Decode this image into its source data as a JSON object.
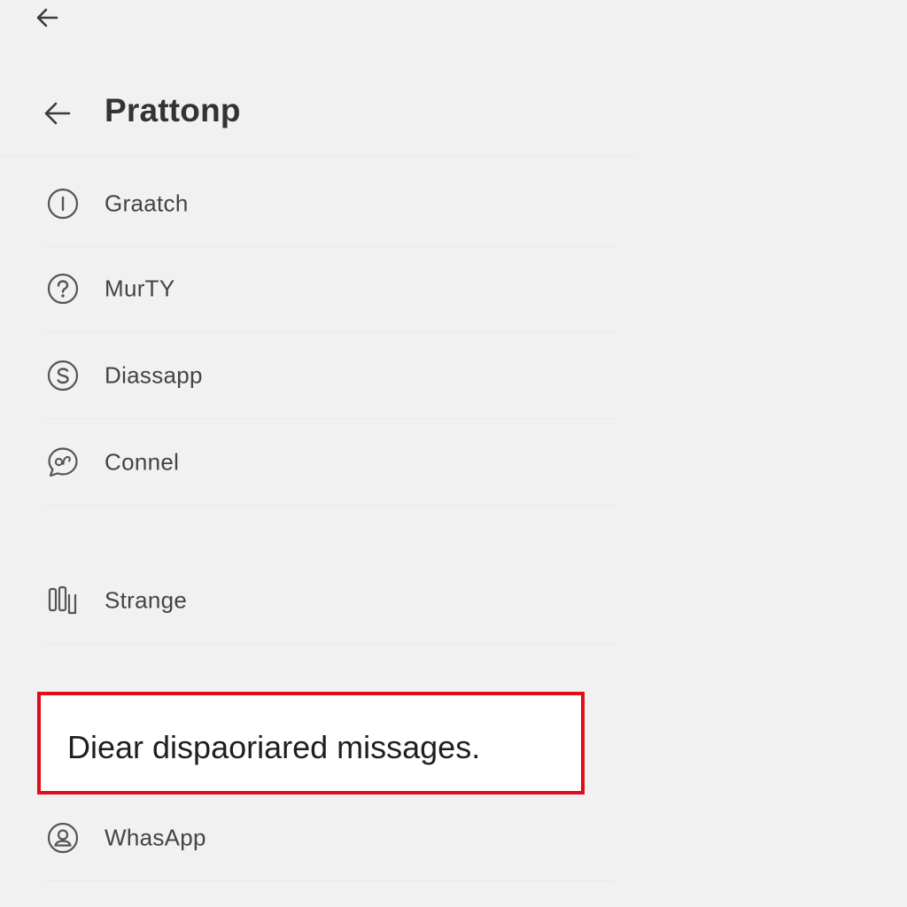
{
  "header": {
    "title": "Prattonp"
  },
  "menu": {
    "items": [
      {
        "label": "Graatch",
        "icon": "info-circle-icon"
      },
      {
        "label": "MurTY",
        "icon": "help-circle-icon"
      },
      {
        "label": "Diassapp",
        "icon": "s-circle-icon"
      },
      {
        "label": "Connel",
        "icon": "chat-bubble-icon"
      },
      {
        "label": "Strange",
        "icon": "storage-bars-icon"
      },
      {
        "label": "WhasApp",
        "icon": "account-circle-icon"
      }
    ]
  },
  "callout": {
    "text": "Diear dispaoriared missages."
  },
  "colors": {
    "background": "#f1f1f1",
    "callout_border": "#e10d18",
    "text": "#444444",
    "title": "#333333"
  }
}
